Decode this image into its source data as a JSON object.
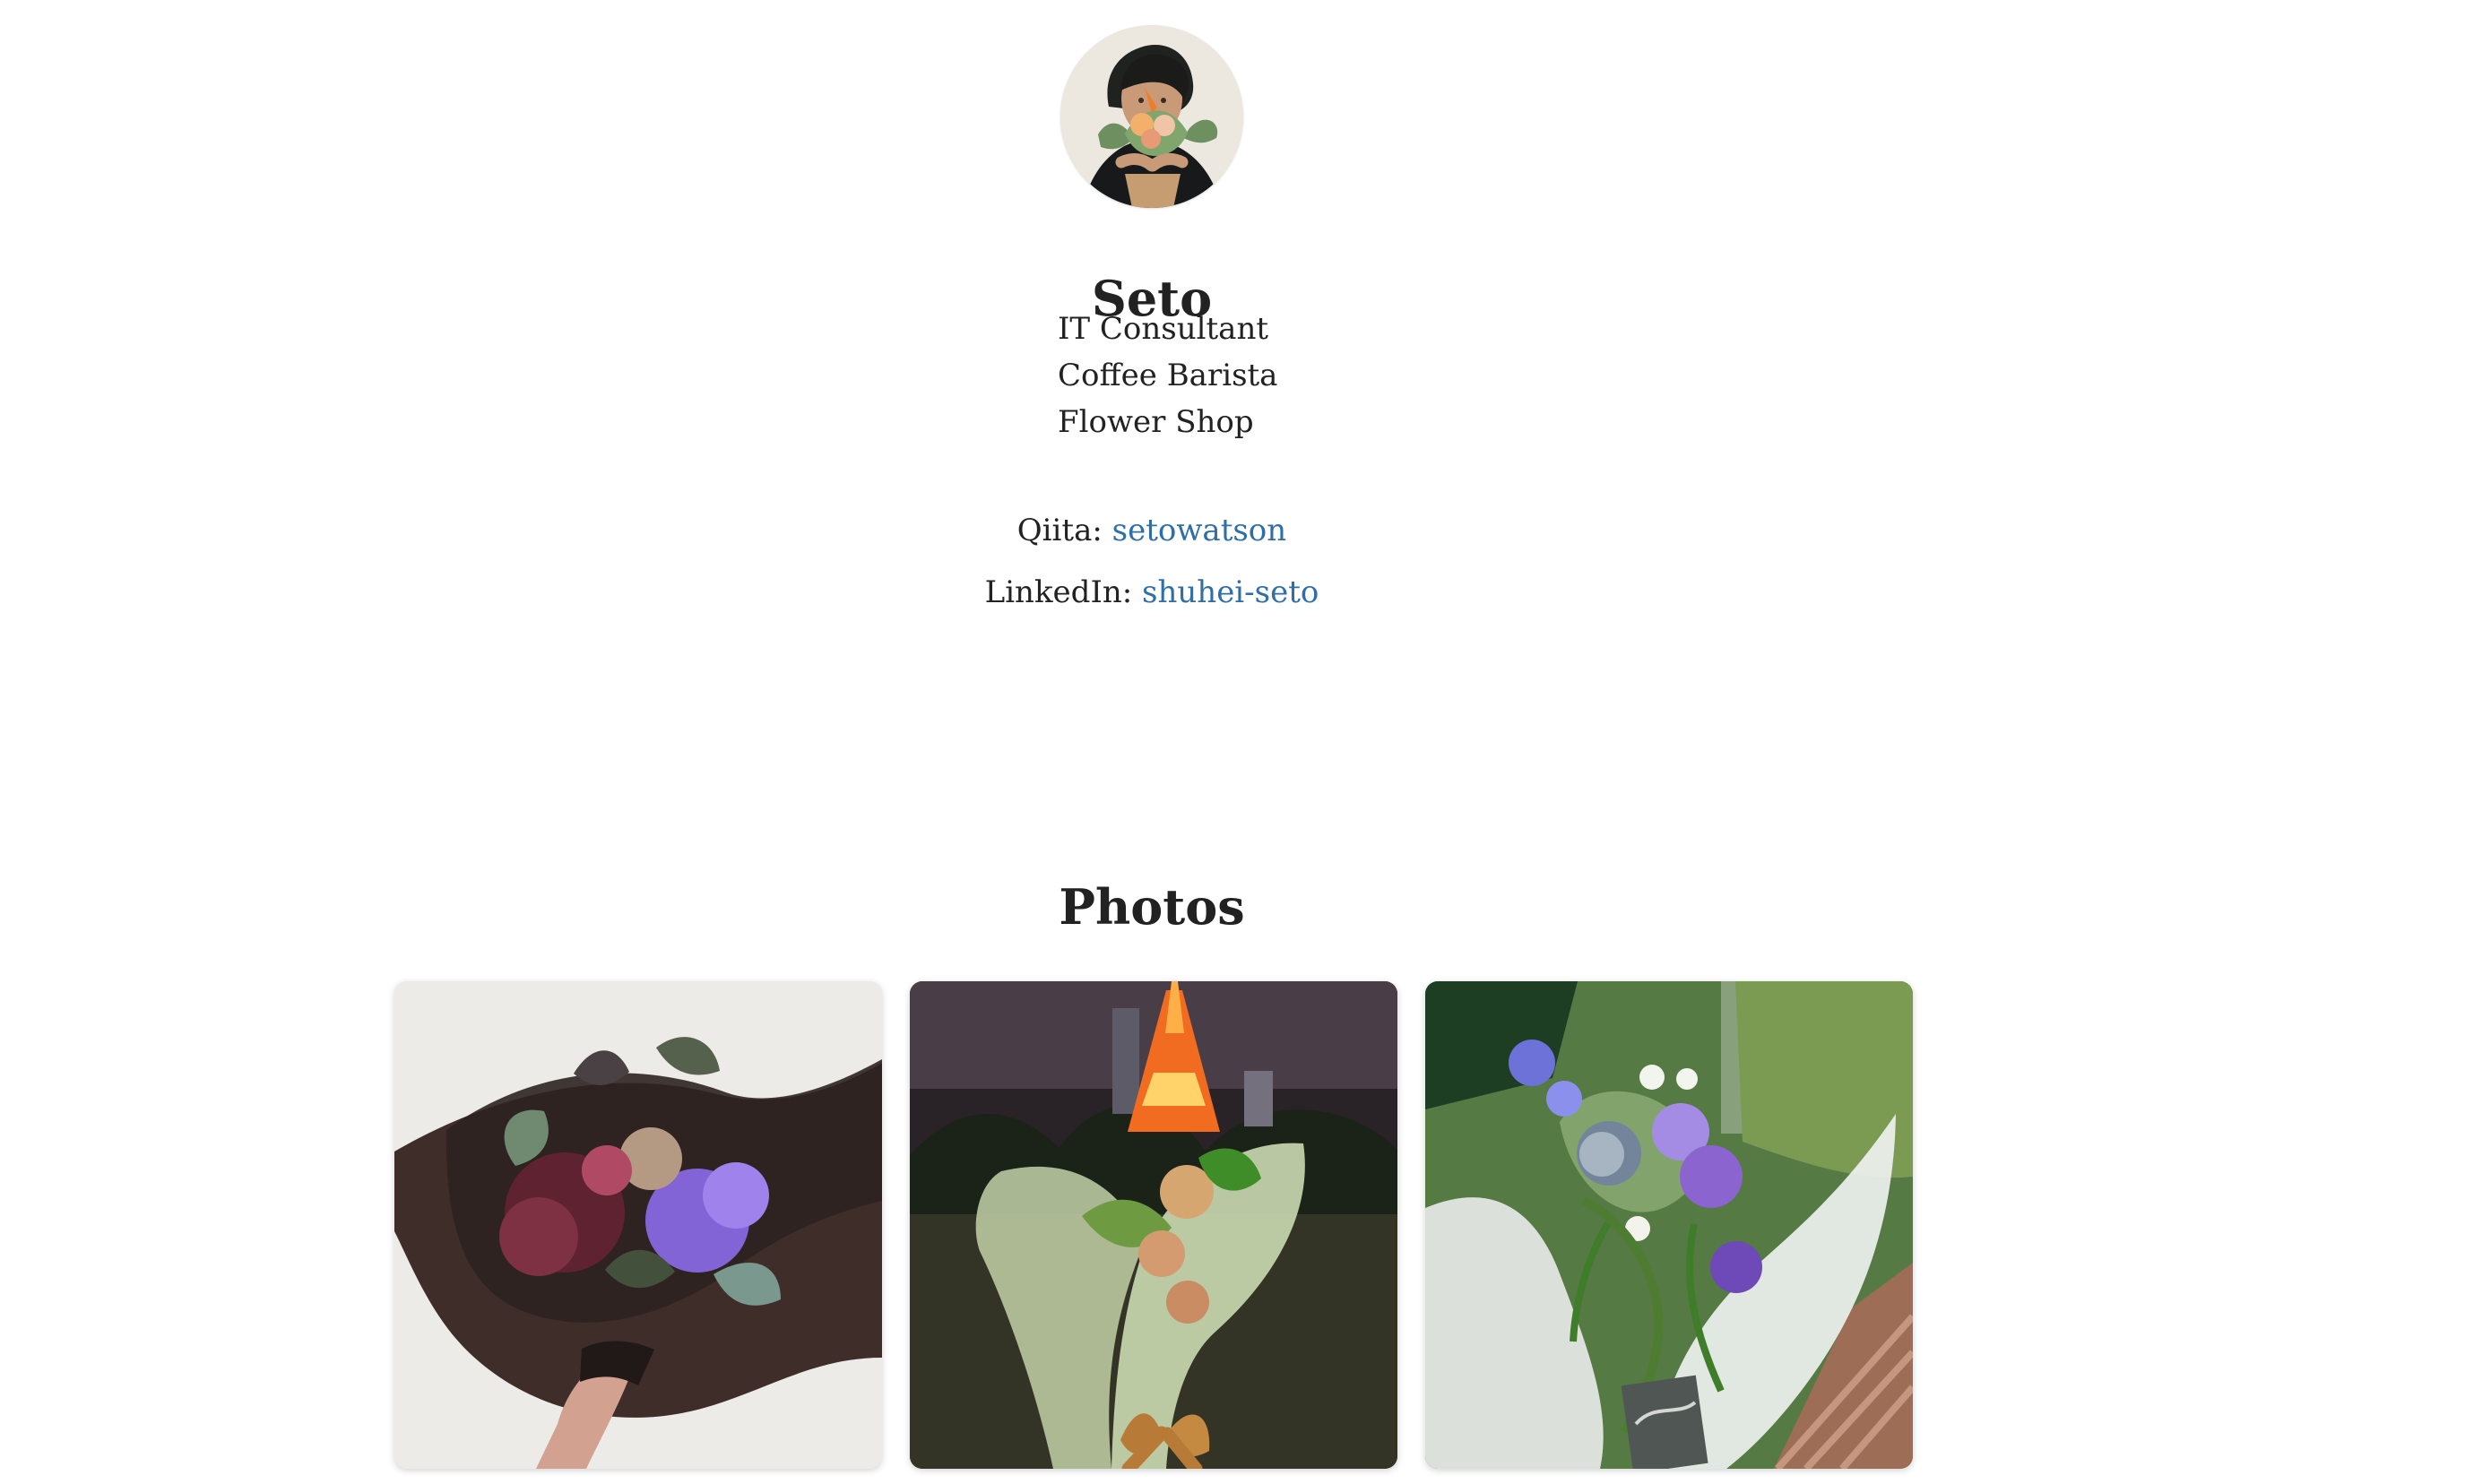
{
  "profile": {
    "name": "Seto",
    "roles": [
      "IT Consultant",
      "Coffee Barista",
      "Flower Shop"
    ],
    "avatar_icon": "profile-photo-flower-bouquet"
  },
  "links": [
    {
      "label": "Qiita: ",
      "value": "setowatson",
      "color": "#2f6ea6"
    },
    {
      "label": "LinkedIn: ",
      "value": "shuhei-seto",
      "color": "#2f6ea6"
    }
  ],
  "photos": {
    "title": "Photos",
    "items": [
      {
        "name": "purple-hydrangea-bouquet",
        "icon": "photo-thumbnail-icon"
      },
      {
        "name": "tokyo-tower-bouquet",
        "icon": "photo-thumbnail-icon"
      },
      {
        "name": "wildflower-bouquet",
        "icon": "photo-thumbnail-icon"
      }
    ]
  },
  "theme": {
    "background": "#ffffff",
    "text": "#222222",
    "link": "#2f6ea6"
  }
}
